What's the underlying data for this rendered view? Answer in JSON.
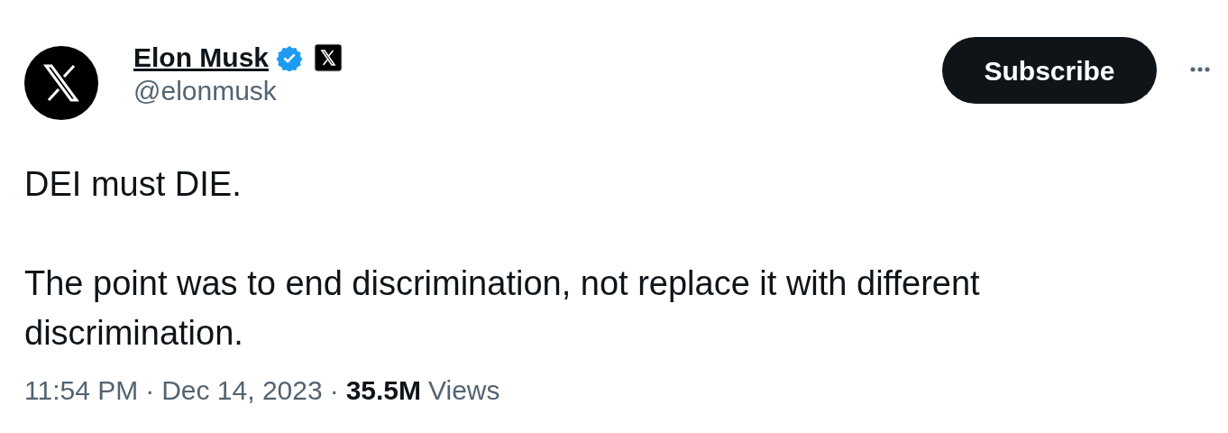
{
  "author": {
    "name": "Elon Musk",
    "handle": "@elonmusk",
    "verified": true
  },
  "subscribe_button": {
    "label": "Subscribe"
  },
  "tweet": {
    "paragraphs": [
      "DEI must DIE.",
      "The point was to end discrimination, not replace it with different discrimination."
    ]
  },
  "meta": {
    "time": "11:54 PM",
    "separator_1": "·",
    "date": "Dec 14, 2023",
    "separator_2": "·",
    "views_count": "35.5M",
    "views_label": "Views"
  }
}
